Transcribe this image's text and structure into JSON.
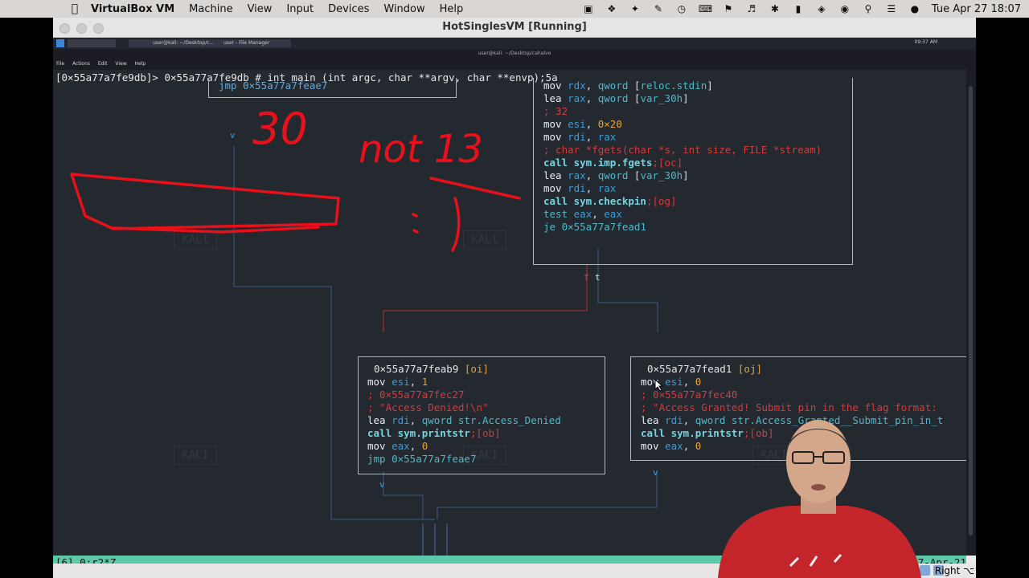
{
  "menubar": {
    "app": "VirtualBox VM",
    "items": [
      "Machine",
      "View",
      "Input",
      "Devices",
      "Window",
      "Help"
    ],
    "datetime": "Tue Apr 27  18:07"
  },
  "window": {
    "title": "HotSinglesVM [Running]"
  },
  "kali": {
    "task1": "user@kali: ~/Desktop/c...",
    "task2": "user - File Manager",
    "clock": "09:37 AM",
    "term_title": "user@kali: ~/Desktop/cahalve",
    "menu": [
      "File",
      "Actions",
      "Edit",
      "View",
      "Help"
    ]
  },
  "terminal": {
    "command": "[0×55a77a7fe9db]> 0×55a77a7fe9db # int main (int argc, char **argv, char **envp);5a",
    "top_box": "jmp 0×55a77a7feae7",
    "main_box": [
      {
        "op": "mov",
        "args": "rdx, qword [reloc.stdin]"
      },
      {
        "op": "lea",
        "args": "rax, qword [var_30h]"
      },
      {
        "comment": "; 32"
      },
      {
        "op": "mov",
        "args": "esi, 0×20"
      },
      {
        "op": "mov",
        "args": "rdi, rax"
      },
      {
        "comment": "; char *fgets(char *s, int size, FILE *stream)"
      },
      {
        "call": "call sym.imp.fgets",
        "tag": ";[oc]"
      },
      {
        "op": "lea",
        "args": "rax, qword [var_30h]"
      },
      {
        "op": "mov",
        "args": "rdi, rax"
      },
      {
        "call": "call sym.checkpin",
        "tag": ";[og]"
      },
      {
        "op": "test",
        "args": "eax, eax"
      },
      {
        "op": "je",
        "args": "0×55a77a7fead1"
      }
    ],
    "branch_false": "f",
    "branch_true": "t",
    "denied_box": {
      "header": "0×55a77a7feab9",
      "tag": "[oi]",
      "lines": [
        {
          "op": "mov",
          "args": "esi, 1"
        },
        {
          "comment": "; 0×55a77a7fec27"
        },
        {
          "comment": "; \"Access Denied!\\n\""
        },
        {
          "op": "lea",
          "args": "rdi, qword str.Access_Denied"
        },
        {
          "call": "call sym.printstr",
          "tag": ";[ob]"
        },
        {
          "op": "mov",
          "args": "eax, 0"
        },
        {
          "op": "jmp",
          "args": "0×55a77a7feae7"
        }
      ]
    },
    "granted_box": {
      "header": "0×55a77a7fead1",
      "tag": "[oj]",
      "lines": [
        {
          "op": "mov",
          "args": "esi, 0"
        },
        {
          "comment": "; 0×55a77a7fec40"
        },
        {
          "comment": "; \"Access Granted! Submit pin in the flag format:"
        },
        {
          "op": "lea",
          "args": "rdi, qword str.Access_Granted__Submit_pin_in_t"
        },
        {
          "call": "call sym.printstr",
          "tag": ";[ob]"
        },
        {
          "op": "mov",
          "args": "eax, 0"
        }
      ]
    },
    "watermark": "KALI",
    "arrow_v": "v"
  },
  "annotations": {
    "number": "30",
    "text": "not 13",
    "smile": ":)"
  },
  "tmux": {
    "left": "[6] 0:r2*Z",
    "right": "7-Apr-21"
  },
  "vbox_status": {
    "hostkey": "Right ⌥"
  },
  "colors": {
    "terminal_bg": "#24282f",
    "status_green": "#5ccaa8",
    "annotation_red": "#e8101a",
    "comment_red": "#d23c3c",
    "register_blue": "#3d9bd7",
    "number_orange": "#e6a33b"
  }
}
